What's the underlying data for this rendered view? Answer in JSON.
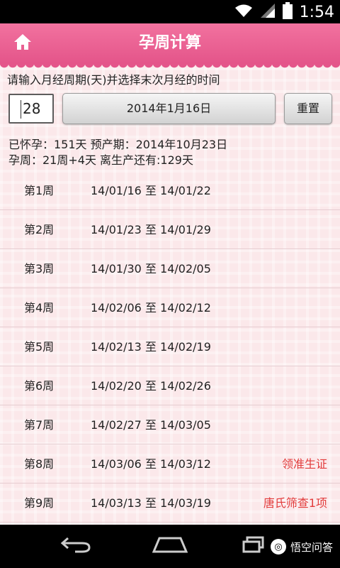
{
  "status_bar": {
    "time": "1:54",
    "icons": [
      "wifi-icon",
      "signal-icon",
      "battery-icon"
    ]
  },
  "header": {
    "title": "孕周计算",
    "home_icon": "home-icon"
  },
  "form": {
    "prompt": "请输入月经周期(天)并选择末次月经的时间",
    "cycle_value": "28",
    "date_label": "2014年1月16日",
    "reset_label": "重置"
  },
  "summary": {
    "line1": "已怀孕：151天 预产期：2014年10月23日",
    "line2": "孕周：21周+4天 离生产还有:129天"
  },
  "weeks": [
    {
      "week": "第1周",
      "range": "14/01/16 至 14/01/22",
      "note": ""
    },
    {
      "week": "第2周",
      "range": "14/01/23 至 14/01/29",
      "note": ""
    },
    {
      "week": "第3周",
      "range": "14/01/30 至 14/02/05",
      "note": ""
    },
    {
      "week": "第4周",
      "range": "14/02/06 至 14/02/12",
      "note": ""
    },
    {
      "week": "第5周",
      "range": "14/02/13 至 14/02/19",
      "note": ""
    },
    {
      "week": "第6周",
      "range": "14/02/20 至 14/02/26",
      "note": ""
    },
    {
      "week": "第7周",
      "range": "14/02/27 至 14/03/05",
      "note": ""
    },
    {
      "week": "第8周",
      "range": "14/03/06 至 14/03/12",
      "note": "领准生证"
    },
    {
      "week": "第9周",
      "range": "14/03/13 至 14/03/19",
      "note": "唐氏筛查1项"
    }
  ],
  "nav_bar": {
    "watermark": "悟空问答"
  },
  "colors": {
    "header_pink": "#e4558a",
    "note_red": "#e23b3b",
    "background_pink": "#fbe8ea"
  }
}
